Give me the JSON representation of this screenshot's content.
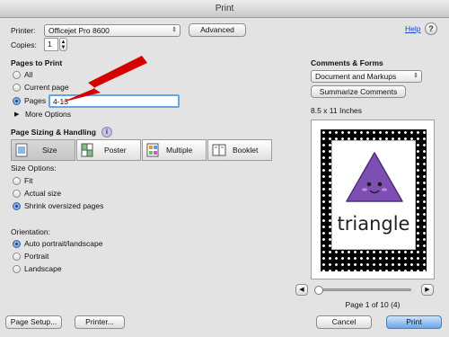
{
  "window": {
    "title": "Print"
  },
  "printer": {
    "label": "Printer:",
    "value": "Officejet Pro 8600",
    "advanced_label": "Advanced",
    "help_label": "Help"
  },
  "copies": {
    "label": "Copies:",
    "value": "1"
  },
  "pages_to_print": {
    "heading": "Pages to Print",
    "options": [
      {
        "label": "All",
        "selected": false
      },
      {
        "label": "Current page",
        "selected": false
      },
      {
        "label": "Pages",
        "selected": true
      }
    ],
    "pages_value": "4-13",
    "more_options_label": "More Options"
  },
  "comments_forms": {
    "heading": "Comments & Forms",
    "value": "Document and Markups",
    "summarize_label": "Summarize Comments"
  },
  "paper_size": "8.5 x 11 Inches",
  "page_sizing": {
    "heading": "Page Sizing & Handling",
    "tabs": [
      {
        "label": "Size",
        "selected": true,
        "icon": "size-icon"
      },
      {
        "label": "Poster",
        "selected": false,
        "icon": "poster-icon"
      },
      {
        "label": "Multiple",
        "selected": false,
        "icon": "multiple-icon"
      },
      {
        "label": "Booklet",
        "selected": false,
        "icon": "booklet-icon"
      }
    ],
    "size_options_label": "Size Options:",
    "size_options": [
      {
        "label": "Fit",
        "selected": false
      },
      {
        "label": "Actual size",
        "selected": false
      },
      {
        "label": "Shrink oversized pages",
        "selected": true
      }
    ]
  },
  "orientation": {
    "label": "Orientation:",
    "options": [
      {
        "label": "Auto portrait/landscape",
        "selected": true
      },
      {
        "label": "Portrait",
        "selected": false
      },
      {
        "label": "Landscape",
        "selected": false
      }
    ]
  },
  "preview": {
    "word": "triangle",
    "page_status": "Page 1 of 10 (4)",
    "slider_position": 0
  },
  "footer": {
    "page_setup_label": "Page Setup...",
    "printer_label": "Printer...",
    "cancel_label": "Cancel",
    "print_label": "Print"
  },
  "colors": {
    "accent": "#3b7fd9",
    "arrow": "#d40000",
    "triangle": "#7d4fb3",
    "dots_bg": "#000000"
  }
}
